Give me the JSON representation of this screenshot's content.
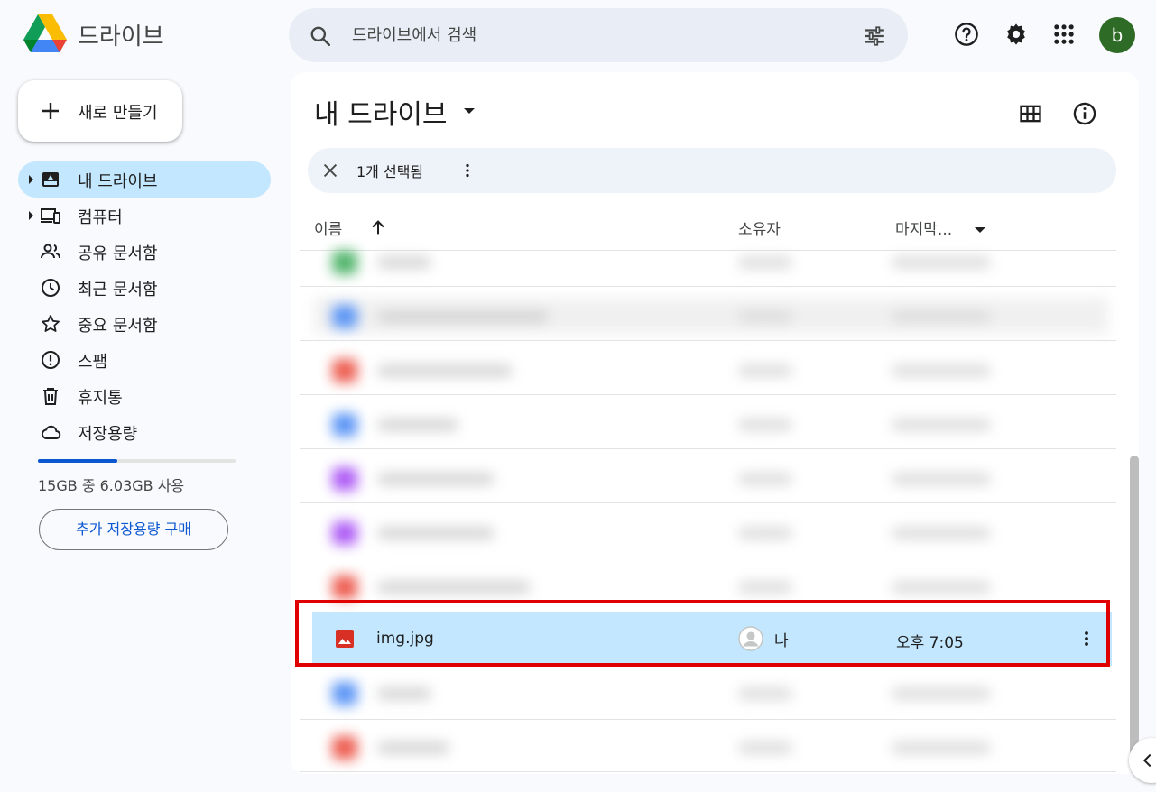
{
  "app": {
    "name": "드라이브"
  },
  "search": {
    "placeholder": "드라이브에서 검색"
  },
  "header": {
    "avatar_letter": "b"
  },
  "sidebar": {
    "new_label": "새로 만들기",
    "items": [
      {
        "label": "내 드라이브",
        "icon": "my-drive-icon",
        "active": true,
        "expandable": true
      },
      {
        "label": "컴퓨터",
        "icon": "computers-icon",
        "expandable": true
      },
      {
        "label": "공유 문서함",
        "icon": "shared-icon"
      },
      {
        "label": "최근 문서함",
        "icon": "clock-icon"
      },
      {
        "label": "중요 문서함",
        "icon": "star-icon"
      },
      {
        "label": "스팸",
        "icon": "spam-icon"
      },
      {
        "label": "휴지통",
        "icon": "trash-icon"
      },
      {
        "label": "저장용량",
        "icon": "cloud-icon"
      }
    ],
    "storage": {
      "text": "15GB 중 6.03GB 사용",
      "used_fraction": 0.402
    },
    "buy_storage_label": "추가 저장용량 구매"
  },
  "main": {
    "title": "내 드라이브",
    "selection": {
      "count_label": "1개 선택됨"
    },
    "columns": {
      "name": "이름",
      "owner": "소유자",
      "modified": "마지막..."
    },
    "selected_file": {
      "name": "img.jpg",
      "owner": "나",
      "modified": "오후 7:05"
    }
  },
  "colors": {
    "accent": "#0b57d0",
    "selected": "#c2e7ff",
    "highlight_box": "#e00000",
    "avatar": "#2e6b27"
  }
}
